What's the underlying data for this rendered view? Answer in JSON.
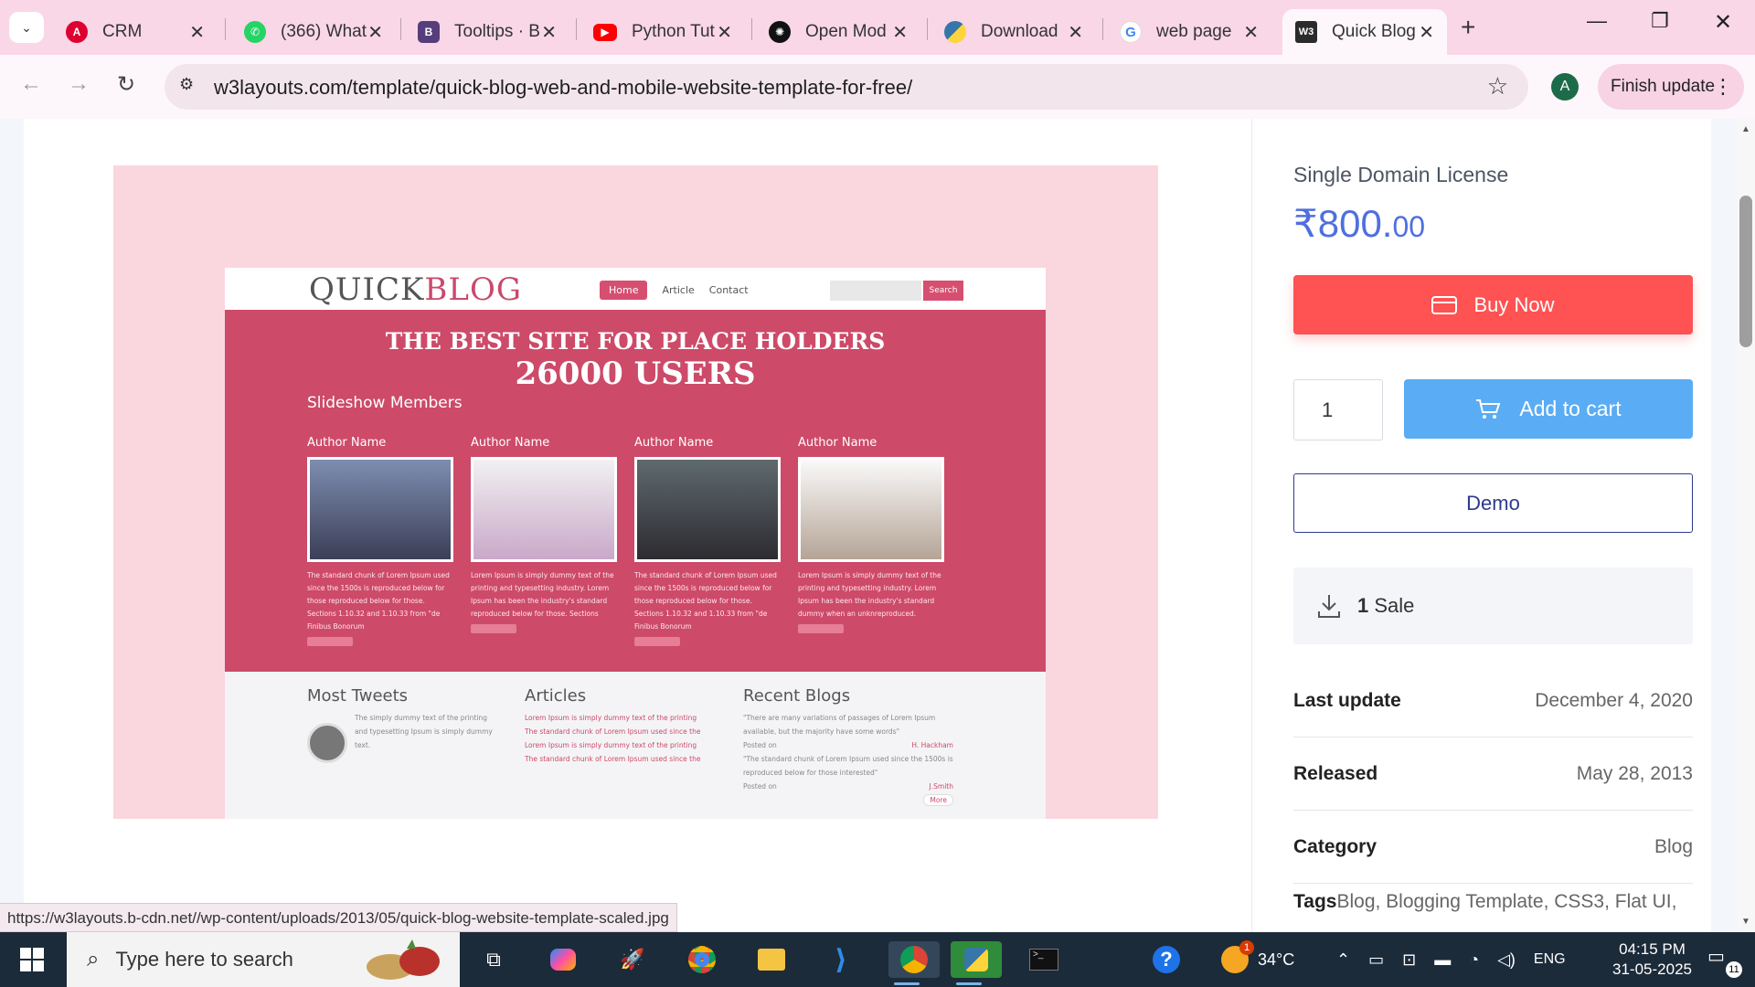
{
  "browser": {
    "tabs": [
      {
        "label": "CRM",
        "icon": "angular-icon",
        "color": "#dd0031"
      },
      {
        "label": "(366) What",
        "icon": "whatsapp-icon",
        "color": "#25d366"
      },
      {
        "label": "Tooltips · B",
        "icon": "bootstrap-icon",
        "color": "#563d7c"
      },
      {
        "label": "Python Tut",
        "icon": "youtube-icon",
        "color": "#ff0000"
      },
      {
        "label": "Open Mod",
        "icon": "openai-icon",
        "color": "#000000"
      },
      {
        "label": "Download",
        "icon": "python-icon",
        "color": "#3776ab"
      },
      {
        "label": "web page",
        "icon": "google-icon",
        "color": "#4285f4"
      },
      {
        "label": "Quick Blog",
        "icon": "w3layouts-icon",
        "color": "#2b2b2b"
      }
    ],
    "url": "w3layouts.com/template/quick-blog-web-and-mobile-website-template-for-free/",
    "profile_initial": "A",
    "finish_update_label": "Finish update",
    "status_url": "https://w3layouts.b-cdn.net//wp-content/uploads/2013/05/quick-blog-website-template-scaled.jpg"
  },
  "preview": {
    "logo_quick": "QUICK",
    "logo_blog": "BLOG",
    "nav": [
      "Home",
      "Article",
      "Contact"
    ],
    "search_btn": "Search",
    "headline1": "THE BEST SITE FOR PLACE HOLDERS",
    "headline2": "26000 USERS",
    "slideshow_title": "Slideshow Members",
    "members": [
      {
        "name": "Author Name",
        "desc": "The standard chunk of Lorem Ipsum used since the 1500s is reproduced below for those reproduced below for those. Sections 1.10.32 and 1.10.33 from \"de Finibus Bonorum"
      },
      {
        "name": "Author Name",
        "desc": "Lorem Ipsum is simply dummy text of the printing and typesetting industry. Lorem Ipsum has been the industry's standard reproduced below for those. Sections"
      },
      {
        "name": "Author Name",
        "desc": "The standard chunk of Lorem Ipsum used since the 1500s is reproduced below for those reproduced below for those. Sections 1.10.32 and 1.10.33 from \"de Finibus Bonorum"
      },
      {
        "name": "Author Name",
        "desc": "Lorem Ipsum is simply dummy text of the printing and typesetting industry. Lorem Ipsum has been the industry's standard dummy when an unknreproduced."
      }
    ],
    "tweets_title": "Most Tweets",
    "tweet_text": "The simply dummy text of the printing and typesetting Ipsum is simply dummy text.",
    "articles_title": "Articles",
    "articles": [
      "Lorem Ipsum is simply dummy text of the printing",
      "The standard chunk of Lorem Ipsum used since the",
      "Lorem Ipsum is simply dummy text of the printing",
      "The standard chunk of Lorem Ipsum used since the"
    ],
    "blogs_title": "Recent Blogs",
    "blog1": "\"There are many variations of passages of Lorem Ipsum available, but the majority have some words\"",
    "blog2": "\"The standard chunk of Lorem Ipsum used since the 1500s is reproduced below for those interested\"",
    "posted_on": "Posted on",
    "author1": "H. Hackham",
    "author2": "J.Smith",
    "more": "More"
  },
  "product": {
    "license": "Single Domain License",
    "price_main": "₹800.",
    "price_decimal": "00",
    "buy_label": "Buy Now",
    "qty": "1",
    "cart_label": "Add to cart",
    "demo_label": "Demo",
    "sales_count": "1",
    "sales_label": "Sale",
    "meta": [
      {
        "key": "Last update",
        "value": "December 4, 2020"
      },
      {
        "key": "Released",
        "value": "May 28, 2013"
      },
      {
        "key": "Category",
        "value": "Blog"
      }
    ],
    "tags_label": "Tags",
    "tags_value": "Blog, Blogging Template, CSS3, Flat UI,"
  },
  "taskbar": {
    "search_placeholder": "Type here to search",
    "weather": "34°C",
    "weather_badge": "1",
    "language": "ENG",
    "time": "04:15 PM",
    "date": "31-05-2025",
    "notif_count": "11"
  }
}
